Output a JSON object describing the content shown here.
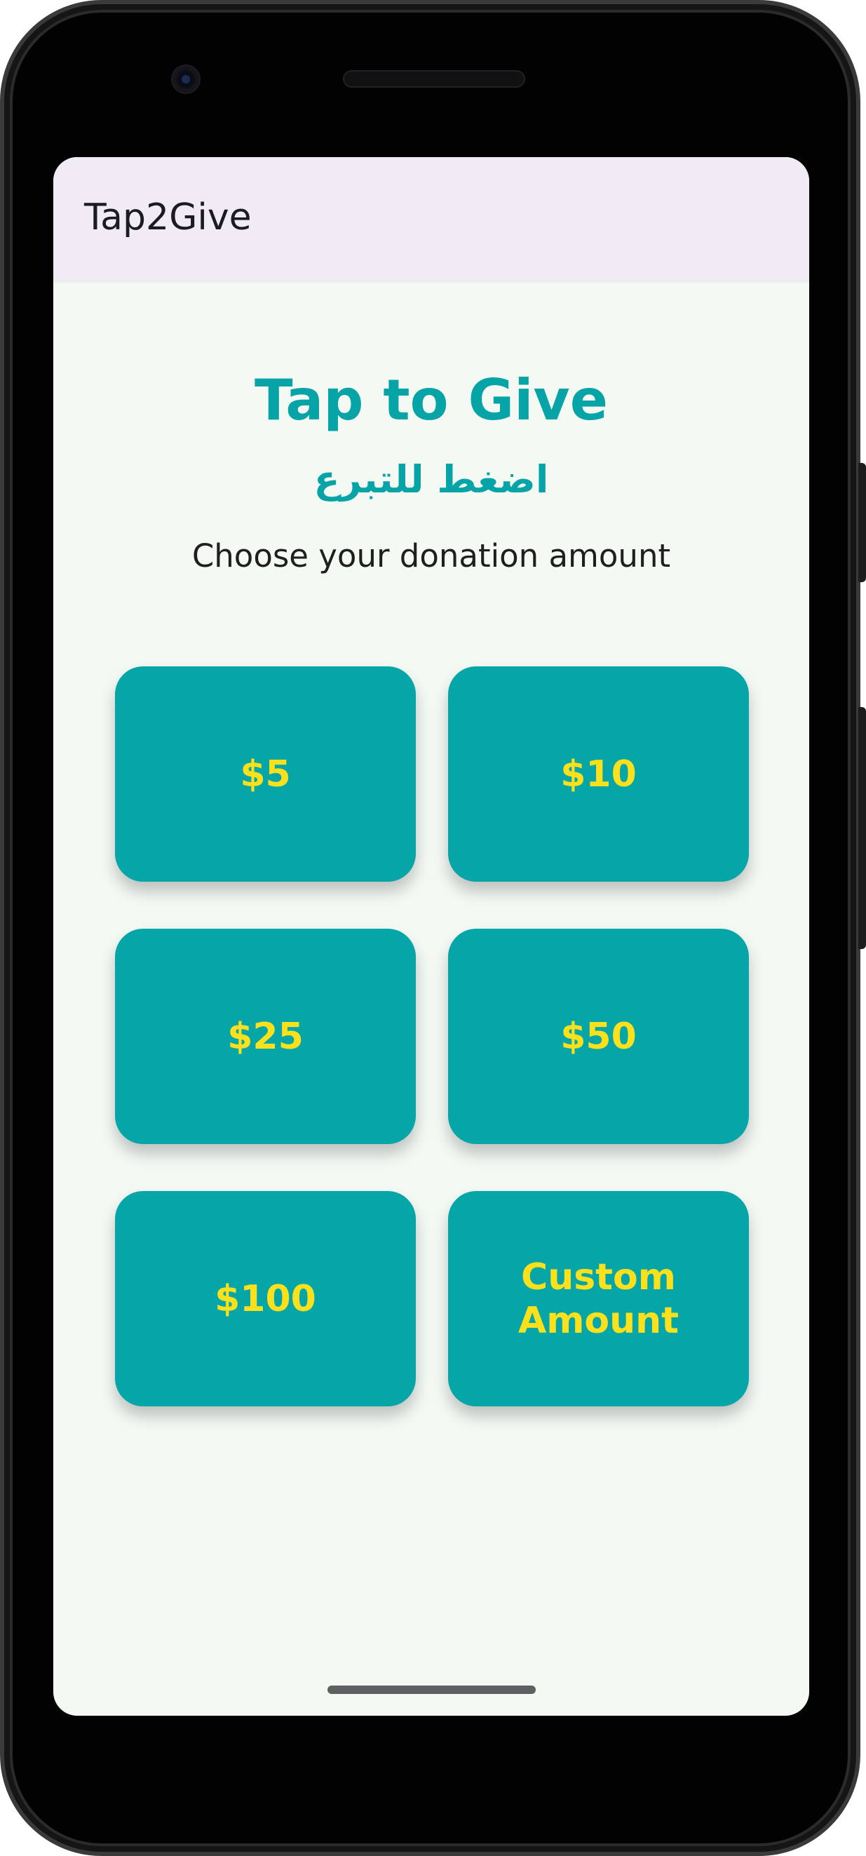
{
  "app_bar": {
    "title": "Tap2Give"
  },
  "main": {
    "heading": "Tap to Give",
    "heading_arabic": "اضغط للتبرع",
    "subtitle": "Choose your donation amount"
  },
  "donation_options": [
    {
      "label": "$5"
    },
    {
      "label": "$10"
    },
    {
      "label": "$25"
    },
    {
      "label": "$50"
    },
    {
      "label": "$100"
    },
    {
      "label_line1": "Custom",
      "label_line2": "Amount"
    }
  ],
  "colors": {
    "accent": "#05a5a8",
    "button_text": "#fbe11c",
    "screen_background": "#f4f9f4",
    "app_bar_background": "#f1ebf6"
  }
}
